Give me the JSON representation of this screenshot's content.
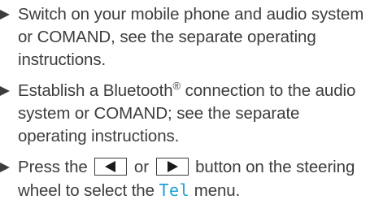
{
  "accent_color": "#19a3d1",
  "steps": [
    {
      "text": "Switch on your mobile phone and audio system or COMAND, see the separate operating instructions."
    },
    {
      "text_before": "Establish a Bluetooth",
      "registered": "®",
      "text_after": " connection to the audio system or COMAND; see the separate operating instructions."
    },
    {
      "text_a": "Press the ",
      "key_left_icon": "left-triangle-icon",
      "text_or": " or ",
      "key_right_icon": "right-triangle-icon",
      "text_b": " button on the steering wheel to select the ",
      "menu_name": "Tel",
      "text_c": " menu."
    }
  ]
}
